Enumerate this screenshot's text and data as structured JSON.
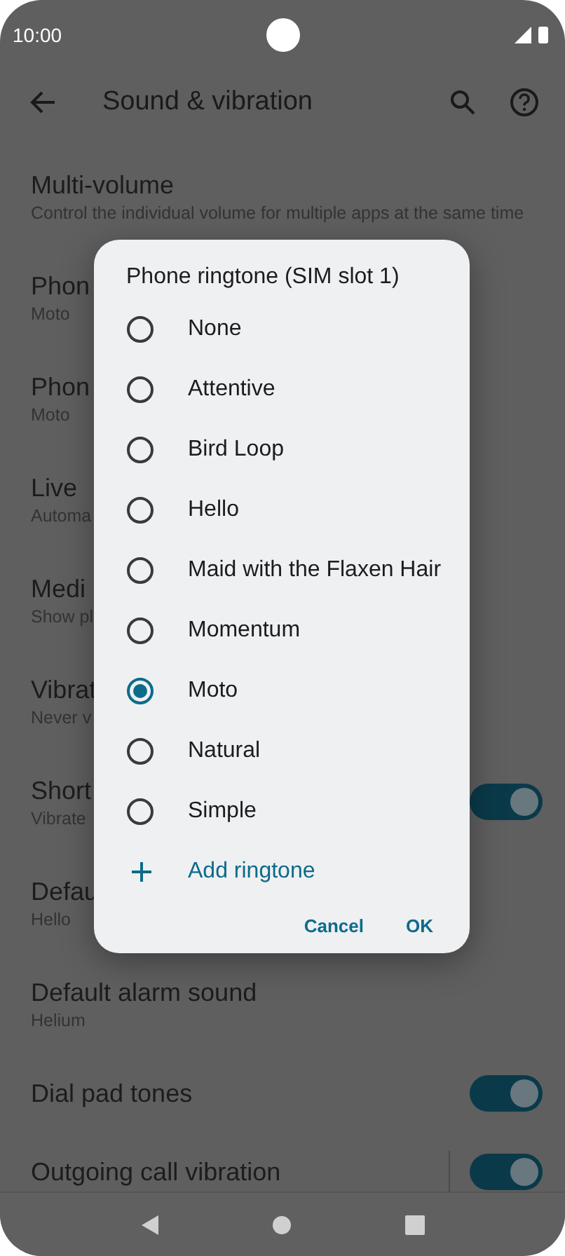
{
  "status_bar": {
    "time": "10:00"
  },
  "toolbar": {
    "title": "Sound & vibration"
  },
  "settings": [
    {
      "title": "Multi-volume",
      "subtitle": "Control the individual volume for multiple apps at the same time"
    },
    {
      "title": "Phon",
      "subtitle": "Moto"
    },
    {
      "title": "Phon",
      "subtitle": "Moto"
    },
    {
      "title": "Live",
      "subtitle": "Automa"
    },
    {
      "title": "Medi",
      "subtitle": "Show pl"
    },
    {
      "title": "Vibrat",
      "subtitle": "Never v"
    },
    {
      "title": "Short",
      "subtitle": "Vibrate",
      "on": true
    },
    {
      "title": "Defau",
      "subtitle": "Hello"
    },
    {
      "title": "Default alarm sound",
      "subtitle": "Helium"
    },
    {
      "title": "Dial pad tones",
      "on": true
    },
    {
      "title": "Outgoing call vibration",
      "on": true,
      "divider": true
    }
  ],
  "dialog": {
    "title": "Phone ringtone (SIM slot 1)",
    "options": [
      {
        "label": "None",
        "selected": false
      },
      {
        "label": "Attentive",
        "selected": false
      },
      {
        "label": "Bird Loop",
        "selected": false
      },
      {
        "label": "Hello",
        "selected": false
      },
      {
        "label": "Maid with the Flaxen Hair",
        "selected": false
      },
      {
        "label": "Momentum",
        "selected": false
      },
      {
        "label": "Moto",
        "selected": true
      },
      {
        "label": "Natural",
        "selected": false
      },
      {
        "label": "Simple",
        "selected": false
      }
    ],
    "add_label": "Add ringtone",
    "buttons": [
      "Cancel",
      "OK"
    ]
  }
}
